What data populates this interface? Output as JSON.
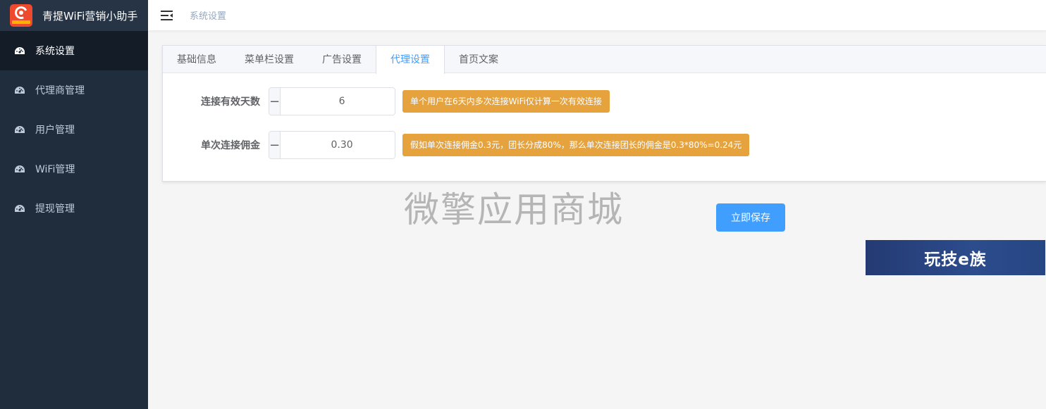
{
  "app": {
    "title": "青提WiFi营销小助手",
    "logo_icon": "logo-icon"
  },
  "colors": {
    "sidebar_bg": "#1f2d3d",
    "accent": "#409eff",
    "hint_bg": "#e6a23c"
  },
  "sidebar": {
    "items": [
      {
        "label": "系统设置",
        "icon": "dashboard-icon",
        "active": true
      },
      {
        "label": "代理商管理",
        "icon": "dashboard-icon",
        "active": false
      },
      {
        "label": "用户管理",
        "icon": "dashboard-icon",
        "active": false
      },
      {
        "label": "WiFi管理",
        "icon": "dashboard-icon",
        "active": false
      },
      {
        "label": "提现管理",
        "icon": "dashboard-icon",
        "active": false
      }
    ]
  },
  "header": {
    "breadcrumb": "系统设置"
  },
  "tabs": [
    {
      "label": "基础信息",
      "active": false
    },
    {
      "label": "菜单栏设置",
      "active": false
    },
    {
      "label": "广告设置",
      "active": false
    },
    {
      "label": "代理设置",
      "active": true
    },
    {
      "label": "首页文案",
      "active": false
    }
  ],
  "form": {
    "days": {
      "label": "连接有效天数",
      "value": "6",
      "hint": "单个用户在6天内多次连接WiFi仅计算一次有效连接"
    },
    "commission": {
      "label": "单次连接佣金",
      "value": "0.30",
      "hint": "假如单次连接佣金0.3元，团长分成80%，那么单次连接团长的佣金是0.3*80%=0.24元"
    },
    "minus_symbol": "−",
    "plus_symbol": "+"
  },
  "watermark": "微擎应用商城",
  "save_button": "立即保存",
  "banner": "玩技e族"
}
